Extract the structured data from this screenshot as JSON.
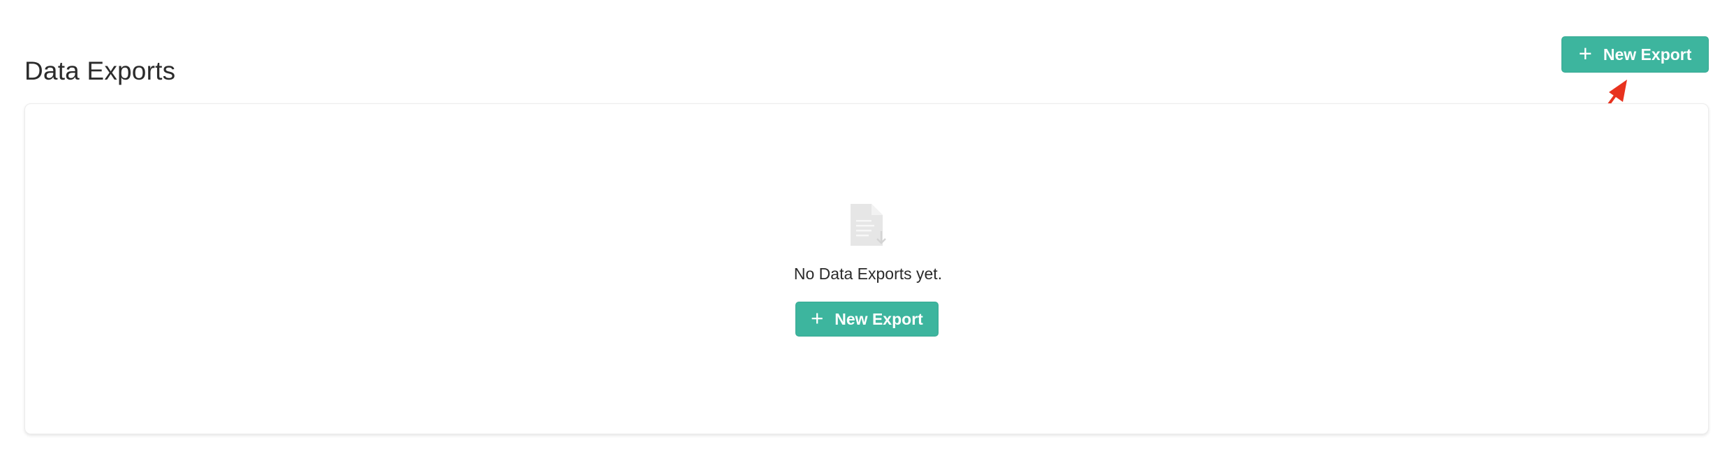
{
  "header": {
    "title": "Data Exports",
    "new_export_label": "New Export",
    "plus_glyph": "+"
  },
  "empty_state": {
    "icon": "document-download-icon",
    "message": "No Data Exports yet.",
    "new_export_label": "New Export",
    "plus_glyph": "+"
  },
  "colors": {
    "accent": "#3db59e",
    "annotation_arrow": "#e8321e",
    "title_text": "#2b2b2b",
    "icon_gray": "#e6e6e6"
  }
}
